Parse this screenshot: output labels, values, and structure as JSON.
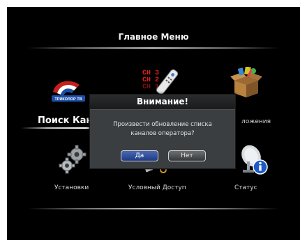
{
  "menu": {
    "title": "Главное Меню",
    "selected_label": "Поиск Кана",
    "items": [
      {
        "label": "Поиск Каналов",
        "icon": "tricolor-tv-logo-icon"
      },
      {
        "label": "CH 3 CH 2",
        "icon": "remote-control-channel-list-icon"
      },
      {
        "label": "Приложения",
        "icon": "box-with-apps-icon"
      },
      {
        "label": "Установки",
        "icon": "gears-icon"
      },
      {
        "label": "Условный Доступ",
        "icon": "access-card-icon"
      },
      {
        "label": "Статус",
        "icon": "satellite-dish-info-icon"
      }
    ],
    "partial_labels": {
      "apps_visible": "ложения"
    },
    "logo_text": "ТРИКОЛОР ТВ",
    "channel_text": [
      "CH 3",
      "CH 2",
      "CH 1"
    ]
  },
  "dialog": {
    "title": "Внимание!",
    "message_line1": "Произвести обновление списка",
    "message_line2": "каналов оператора?",
    "yes_label": "Да",
    "no_label": "Нет"
  },
  "colors": {
    "background": "#000000",
    "dialog_bg": "#3b3e40",
    "yes_button": "#2a4a9a",
    "no_button": "#505356"
  }
}
